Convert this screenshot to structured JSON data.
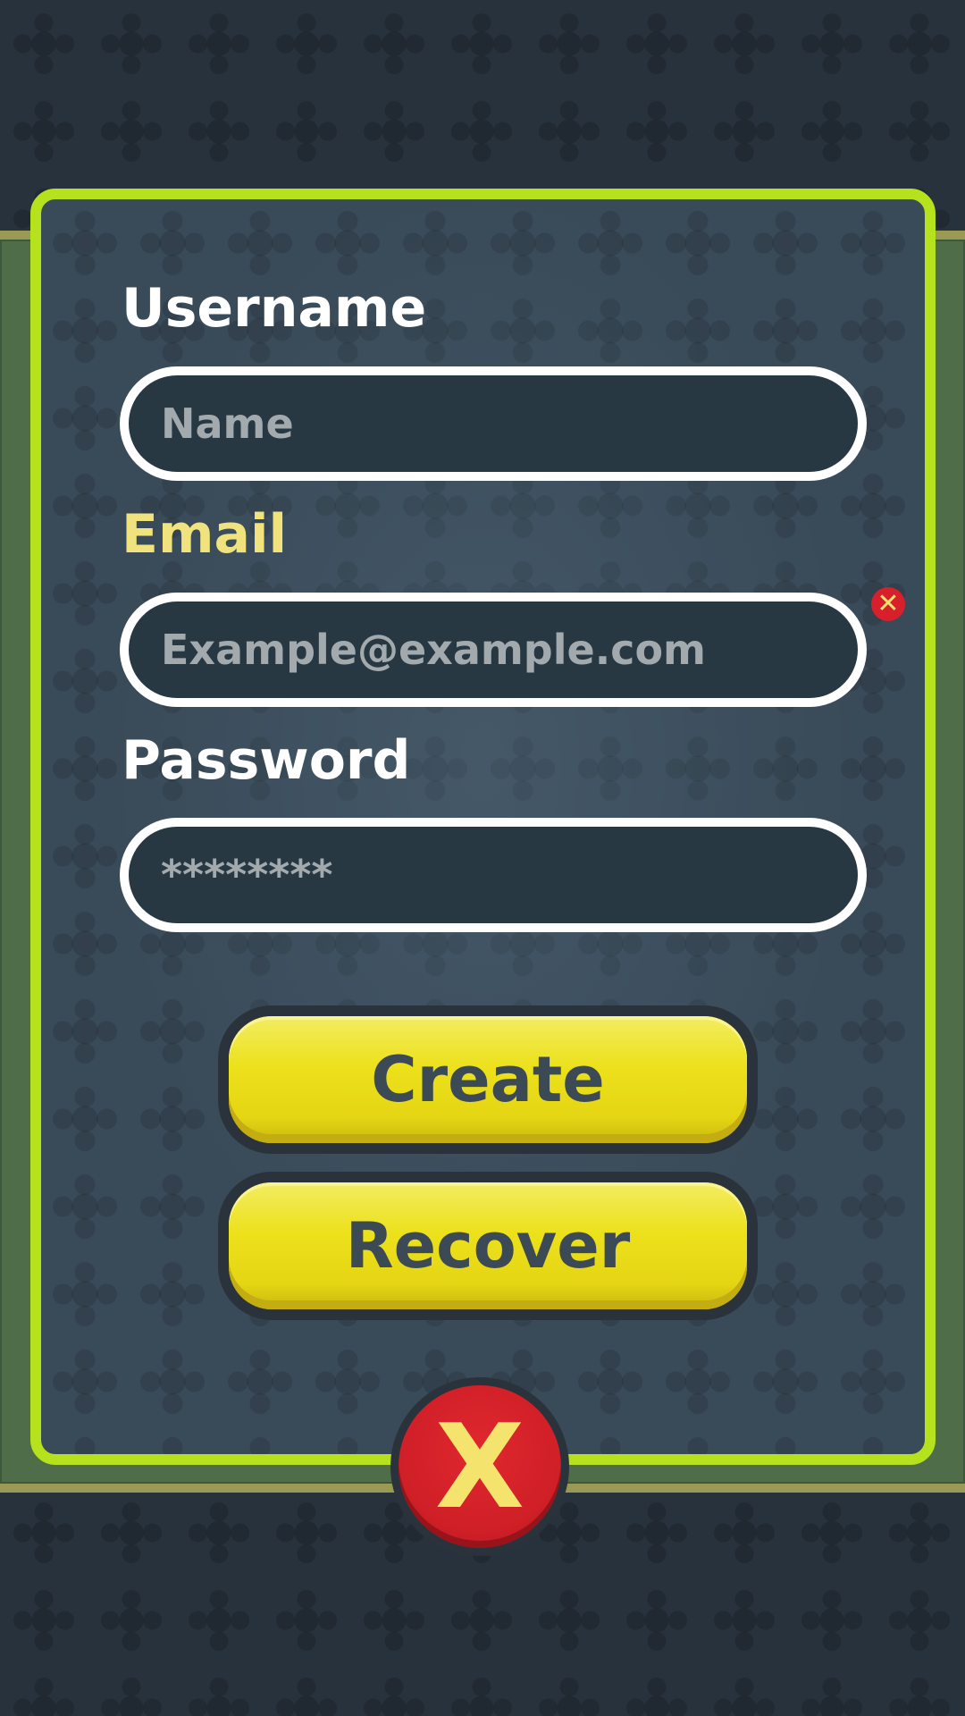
{
  "form": {
    "username": {
      "label": "Username",
      "placeholder": "Name",
      "value": ""
    },
    "email": {
      "label": "Email",
      "placeholder": "Example@example.com",
      "value": "",
      "error_icon": "error-x-icon",
      "error_glyph": "✕"
    },
    "password": {
      "label": "Password",
      "placeholder": "********",
      "value": ""
    }
  },
  "buttons": {
    "create_label": "Create",
    "recover_label": "Recover",
    "close_glyph": "X"
  },
  "colors": {
    "panel_border": "#b5e21c",
    "button_yellow": "#ece11b",
    "close_red": "#cf1f27",
    "label_highlight": "#f0e37e"
  }
}
